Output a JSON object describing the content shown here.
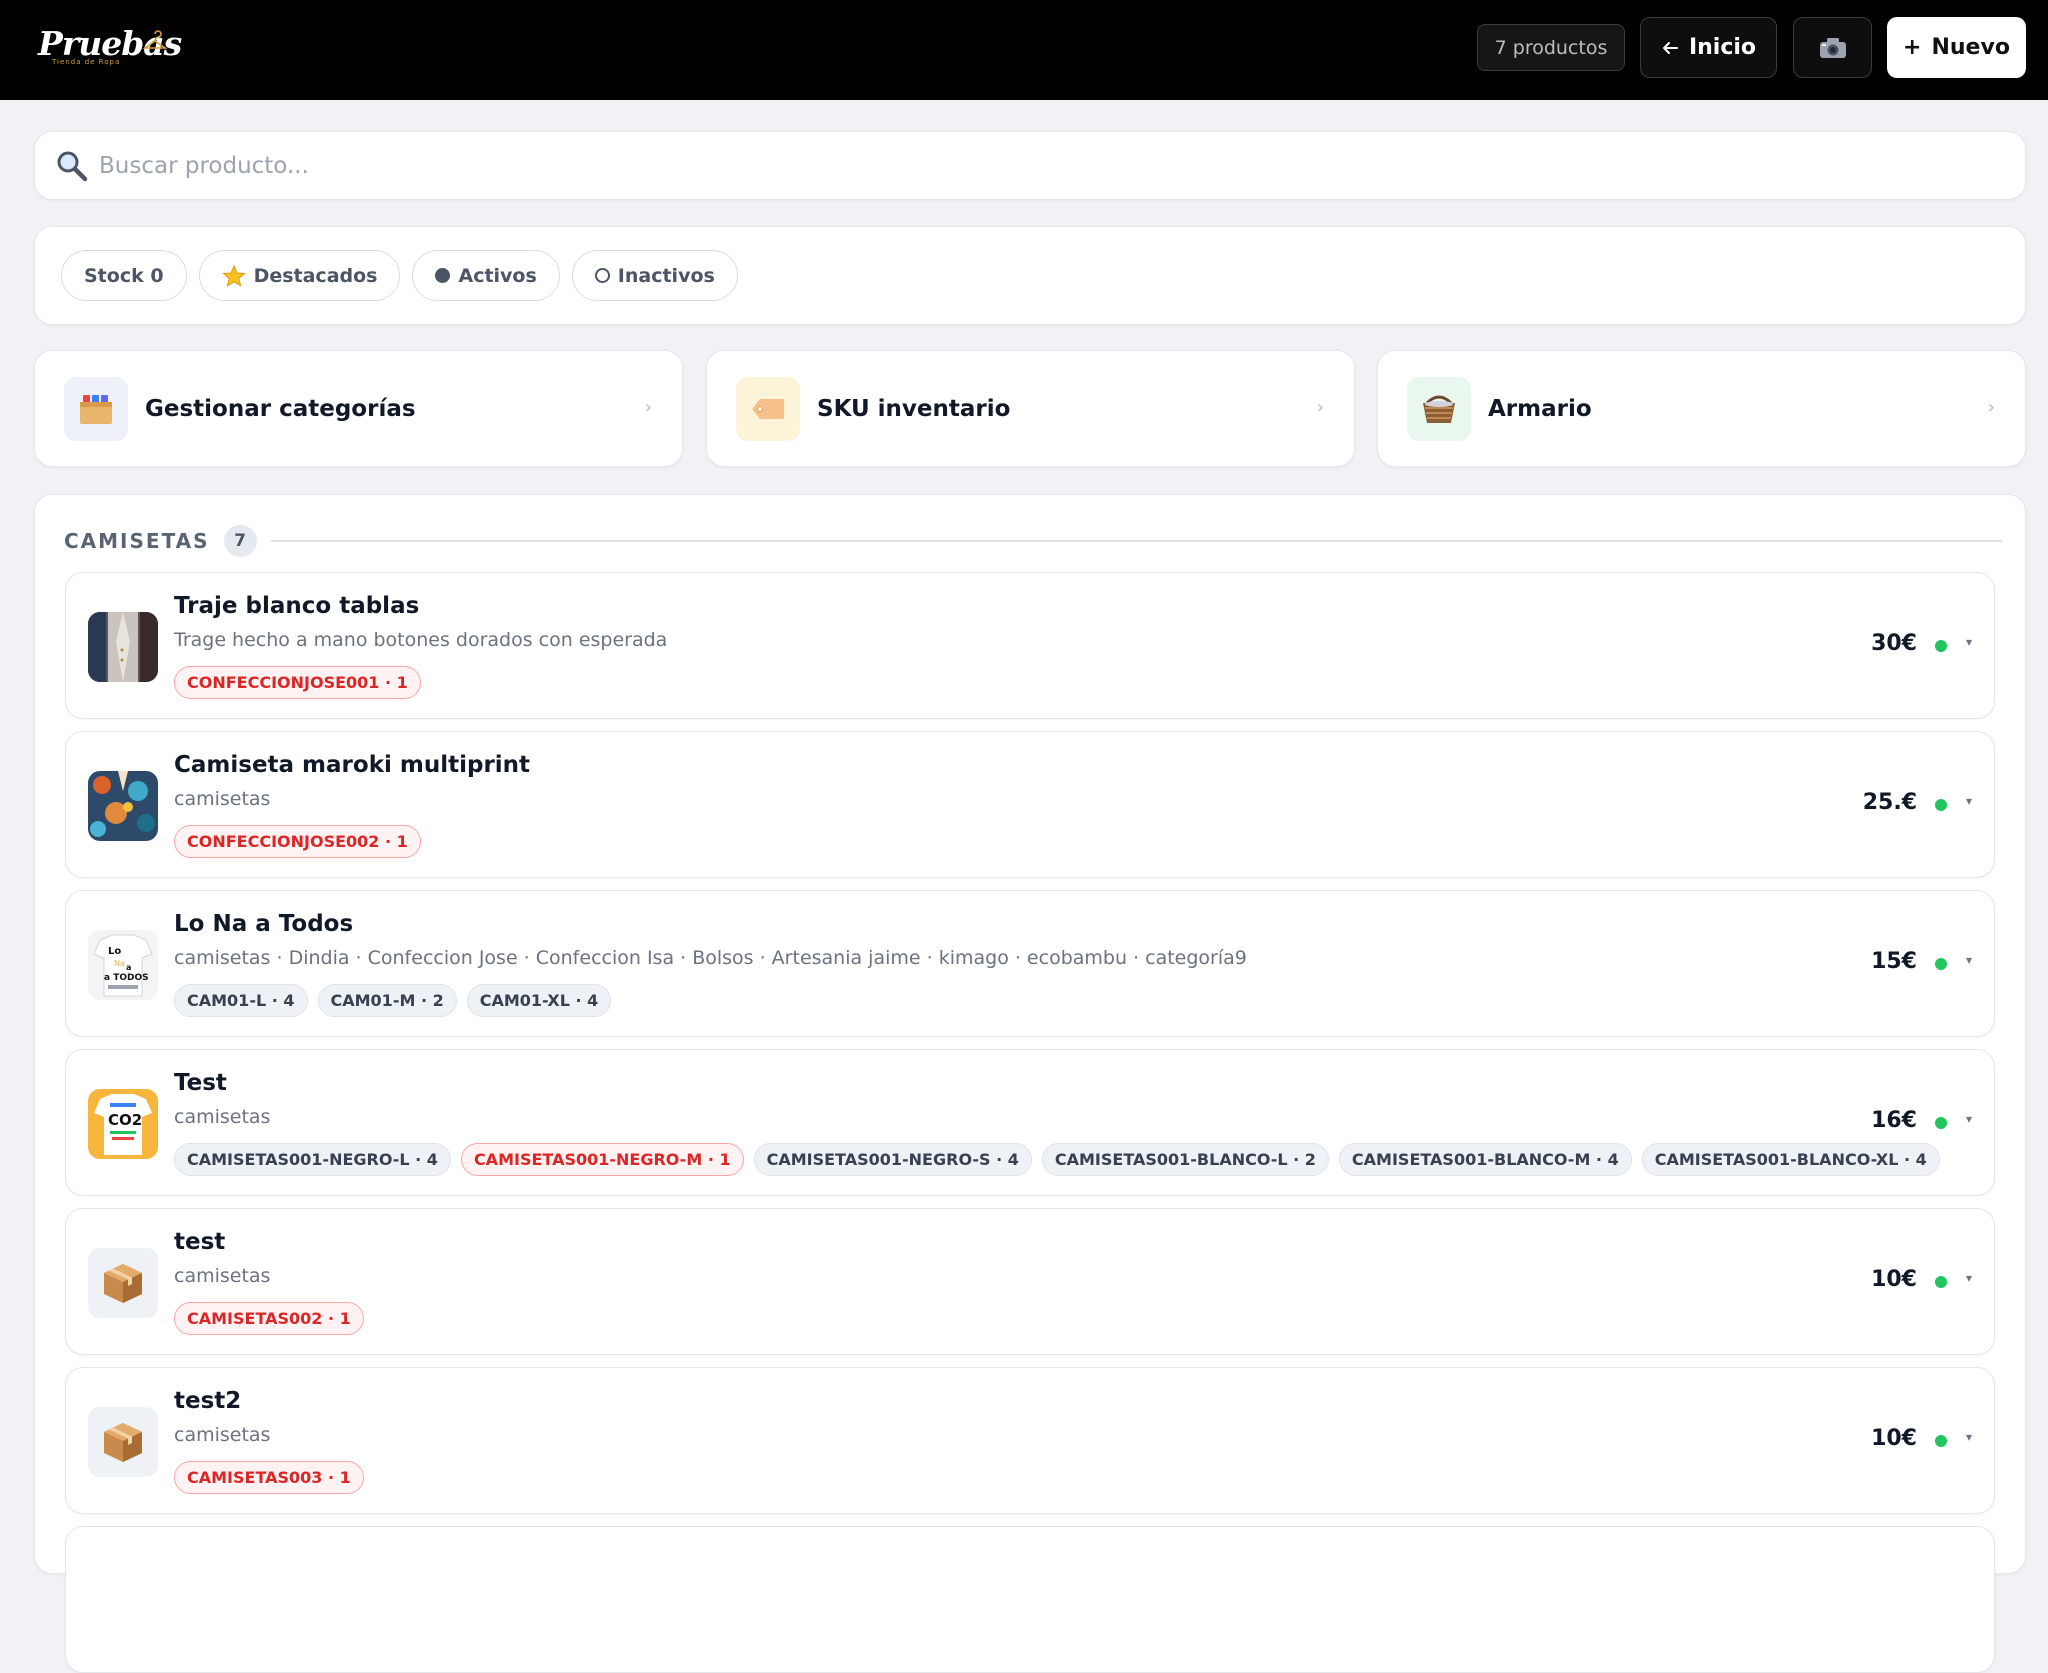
{
  "header": {
    "logo_text": "Pruebas",
    "logo_sub": "Tienda de Ropa",
    "product_count": "7 productos",
    "inicio_label": "Inicio",
    "camera_icon": "camera-icon",
    "nuevo_label": "Nuevo"
  },
  "search": {
    "placeholder": "Buscar producto..."
  },
  "filters": [
    {
      "label": "Stock 0"
    },
    {
      "label": "Destacados",
      "icon": "star-icon"
    },
    {
      "label": "Activos",
      "icon": "filled-circle-icon"
    },
    {
      "label": "Inactivos",
      "icon": "empty-circle-icon"
    }
  ],
  "tiles": [
    {
      "label": "Gestionar categorías",
      "icon": "box-icon",
      "bg": "#eef1f9"
    },
    {
      "label": "SKU inventario",
      "icon": "price-tag-icon",
      "bg": "#fdf3d8"
    },
    {
      "label": "Armario",
      "icon": "basket-icon",
      "bg": "#eaf7ee"
    }
  ],
  "section": {
    "title": "CAMISETAS",
    "count": "7"
  },
  "products": [
    {
      "name": "Traje blanco tablas",
      "desc": "Trage hecho a mano botones dorados con esperada",
      "price": "30€",
      "thumb": "suit-photo",
      "tags": [
        {
          "text": "CONFECCIONJOSE001 · 1",
          "style": "red"
        }
      ]
    },
    {
      "name": "Camiseta maroki multiprint",
      "desc": "camisetas",
      "price": "25.€",
      "thumb": "print-shirt-photo",
      "tags": [
        {
          "text": "CONFECCIONJOSE002 · 1",
          "style": "red"
        }
      ]
    },
    {
      "name": "Lo Na a Todos",
      "desc": "camisetas · Dindia · Confeccion Jose · Confeccion Isa · Bolsos · Artesania jaime · kimago · ecobambu · categoría9",
      "price": "15€",
      "thumb": "lo-na-a-todos-shirt-photo",
      "tags": [
        {
          "text": "CAM01-L · 4",
          "style": "gray"
        },
        {
          "text": "CAM01-M · 2",
          "style": "gray"
        },
        {
          "text": "CAM01-XL · 4",
          "style": "gray"
        }
      ]
    },
    {
      "name": "Test",
      "desc": "camisetas",
      "price": "16€",
      "thumb": "co2-shirt-photo",
      "tags": [
        {
          "text": "CAMISETAS001-NEGRO-L · 4",
          "style": "gray"
        },
        {
          "text": "CAMISETAS001-NEGRO-M · 1",
          "style": "red"
        },
        {
          "text": "CAMISETAS001-NEGRO-S · 4",
          "style": "gray"
        },
        {
          "text": "CAMISETAS001-BLANCO-L · 2",
          "style": "gray"
        },
        {
          "text": "CAMISETAS001-BLANCO-M · 4",
          "style": "gray"
        },
        {
          "text": "CAMISETAS001-BLANCO-XL · 4",
          "style": "gray"
        }
      ]
    },
    {
      "name": "test",
      "desc": "camisetas",
      "price": "10€",
      "thumb": "package-icon",
      "tags": [
        {
          "text": "CAMISETAS002 · 1",
          "style": "red"
        }
      ]
    },
    {
      "name": "test2",
      "desc": "camisetas",
      "price": "10€",
      "thumb": "package-icon",
      "tags": [
        {
          "text": "CAMISETAS003 · 1",
          "style": "red"
        }
      ]
    }
  ],
  "colors": {
    "topbar": "#000000",
    "active_dot": "#22c55e",
    "red_tag": "#dc2626"
  }
}
